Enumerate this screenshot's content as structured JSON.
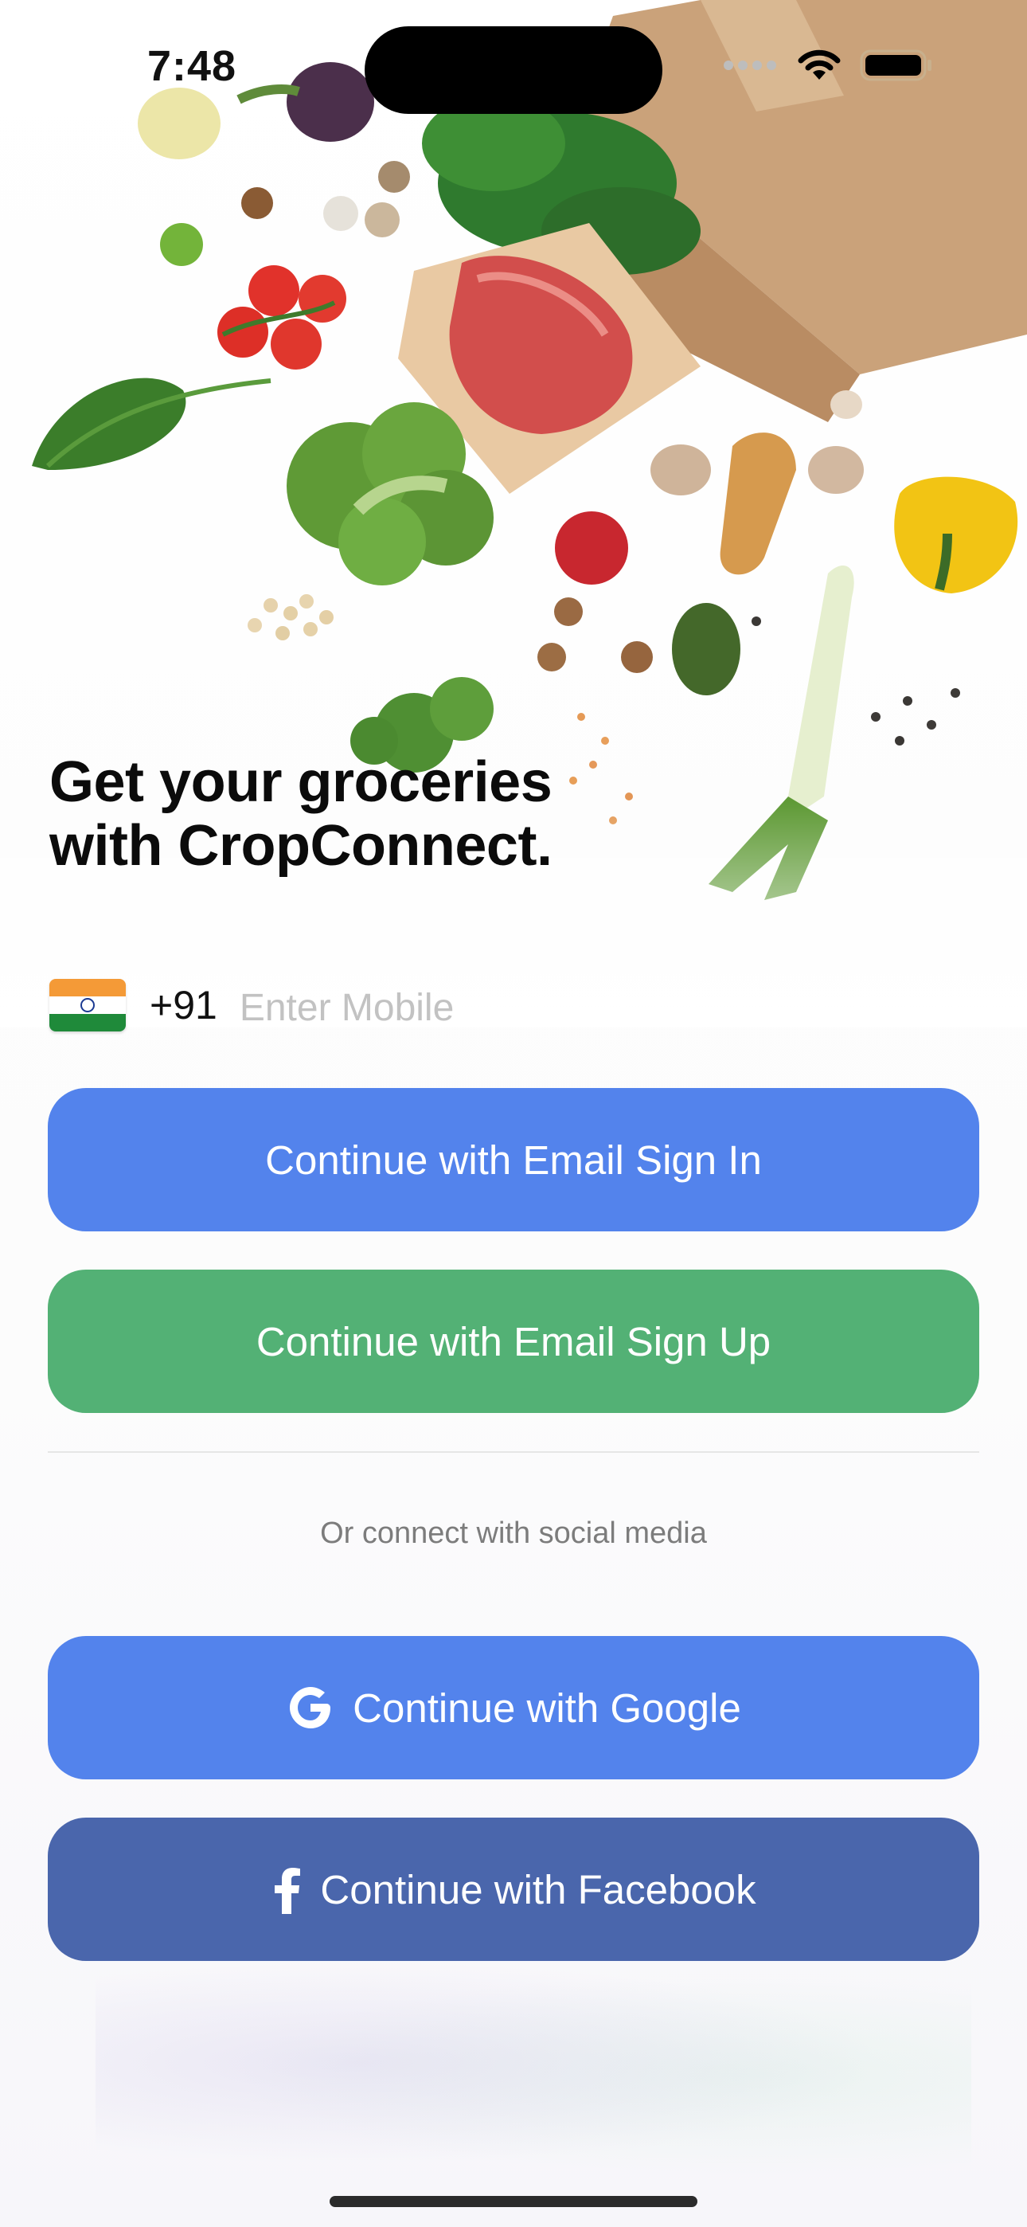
{
  "status_bar": {
    "time": "7:48",
    "wifi_icon": "wifi-icon",
    "battery_icon": "battery-icon",
    "signal_icon": "signal-dots-icon"
  },
  "hero": {
    "headline_line1": "Get your groceries",
    "headline_line2": "with CropConnect."
  },
  "phone": {
    "flag_icon": "india-flag-icon",
    "dial_code": "+91",
    "placeholder": "Enter Mobile",
    "value": ""
  },
  "actions": {
    "email_sign_in": "Continue with Email Sign In",
    "email_sign_up": "Continue with Email Sign Up"
  },
  "social": {
    "caption": "Or connect with social media",
    "google_label": "Continue with Google",
    "facebook_label": "Continue with Facebook"
  },
  "colors": {
    "email_sign_in": "#5383ec",
    "email_sign_up": "#53b175",
    "google": "#5383ec",
    "facebook": "#4a66ac"
  }
}
